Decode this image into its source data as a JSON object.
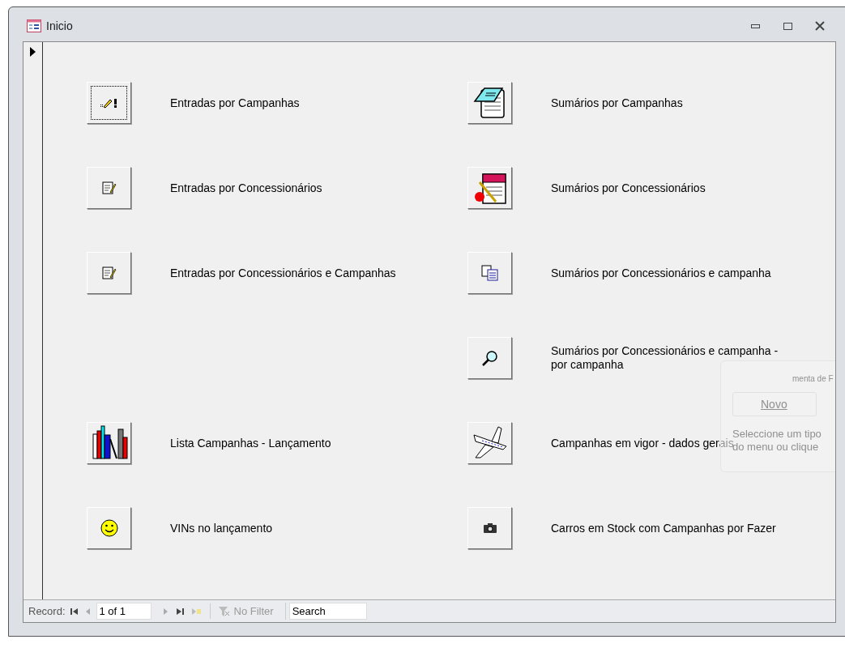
{
  "window": {
    "title": "Inicio"
  },
  "rows": [
    {
      "left": {
        "label": "Entradas por Campanhas",
        "kind": "pencil",
        "focused": true
      },
      "right": {
        "label": "Sumários por Campanhas",
        "kind": "notepad",
        "focused": false
      }
    },
    {
      "left": {
        "label": "Entradas por Concessionários",
        "kind": "note",
        "focused": false
      },
      "right": {
        "label": "Sumários por Concessionários",
        "kind": "redpad",
        "focused": false
      }
    },
    {
      "left": {
        "label": "Entradas por Concessionários e Campanhas",
        "kind": "note",
        "focused": false
      },
      "right": {
        "label": "Sumários por Concessionários e campanha",
        "kind": "copy",
        "focused": false
      }
    },
    {
      "right": {
        "label": "Sumários por Concessionários e campanha - por campanha",
        "kind": "search",
        "focused": false
      }
    },
    {
      "left": {
        "label": "Lista Campanhas - Lançamento",
        "kind": "books",
        "focused": false
      },
      "right": {
        "label": "Campanhas em vigor - dados gerais",
        "kind": "plane",
        "focused": false
      }
    },
    {
      "left": {
        "label": "VINs no lançamento",
        "kind": "smiley",
        "focused": false
      },
      "right": {
        "label": "Carros em Stock com Campanhas por Fazer",
        "kind": "camera",
        "focused": false
      }
    }
  ],
  "ghost_panel": {
    "title": "menta de F",
    "button": "Novo",
    "hint_lines": [
      "Seleccione um tipo",
      "do menu ou clique"
    ]
  },
  "navigation": {
    "label": "Record:",
    "position": "1 of 1",
    "filter": "No Filter",
    "search": "Search"
  }
}
